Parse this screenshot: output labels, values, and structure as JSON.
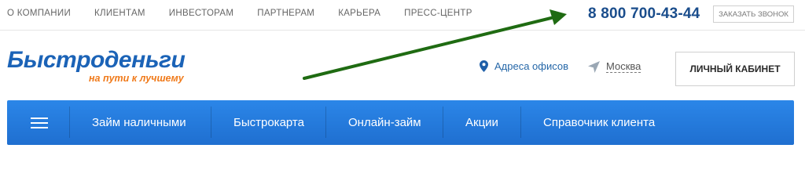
{
  "top_nav": [
    "О КОМПАНИИ",
    "КЛИЕНТАМ",
    "ИНВЕСТОРАМ",
    "ПАРТНЕРАМ",
    "КАРЬЕРА",
    "ПРЕСС-ЦЕНТР"
  ],
  "phone": "8 800 700-43-44",
  "callback_label": "ЗАКАЗАТЬ ЗВОНОК",
  "logo": {
    "main": "Быстроденьги",
    "tagline": "на пути к лучшему"
  },
  "offices_link": "Адреса офисов",
  "city": "Москва",
  "cabinet_label": "ЛИЧНЫЙ КАБИНЕТ",
  "main_nav": [
    "Займ наличными",
    "Быстрокарта",
    "Онлайн-займ",
    "Акции",
    "Справочник клиента"
  ],
  "colors": {
    "brand_blue": "#1b63b7",
    "accent_orange": "#f07a1a",
    "nav_blue": "#2b86e8",
    "annotation_green": "#1f6b12"
  },
  "icons": [
    "location-pin-icon",
    "geolocation-arrow-icon",
    "hamburger-menu-icon"
  ]
}
